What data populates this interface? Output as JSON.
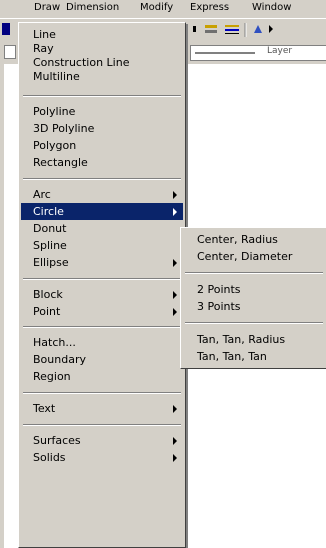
{
  "menubar": {
    "items": [
      "Draw",
      "Dimension",
      "Modify",
      "Express",
      "Window"
    ]
  },
  "toolbar": {
    "layer_field": "Layer"
  },
  "draw_menu": {
    "items": [
      {
        "label": "Line",
        "submenu": false
      },
      {
        "label": "Ray",
        "submenu": false
      },
      {
        "label": "Construction Line",
        "submenu": false
      },
      {
        "label": "Multiline",
        "submenu": false
      },
      {
        "label": "Polyline",
        "submenu": false
      },
      {
        "label": "3D Polyline",
        "submenu": false
      },
      {
        "label": "Polygon",
        "submenu": false
      },
      {
        "label": "Rectangle",
        "submenu": false
      },
      {
        "label": "Arc",
        "submenu": true
      },
      {
        "label": "Circle",
        "submenu": true,
        "selected": true
      },
      {
        "label": "Donut",
        "submenu": false
      },
      {
        "label": "Spline",
        "submenu": false
      },
      {
        "label": "Ellipse",
        "submenu": true
      },
      {
        "label": "Block",
        "submenu": true
      },
      {
        "label": "Point",
        "submenu": true
      },
      {
        "label": "Hatch...",
        "submenu": false
      },
      {
        "label": "Boundary",
        "submenu": false
      },
      {
        "label": "Region",
        "submenu": false
      },
      {
        "label": "Text",
        "submenu": true
      },
      {
        "label": "Surfaces",
        "submenu": true
      },
      {
        "label": "Solids",
        "submenu": true
      }
    ]
  },
  "circle_submenu": {
    "items": [
      "Center, Radius",
      "Center, Diameter",
      "2 Points",
      "3 Points",
      "Tan, Tan, Radius",
      "Tan, Tan, Tan"
    ]
  },
  "colors": {
    "menu_bg": "#d4d0c8",
    "selection": "#0a246a",
    "selection_text": "#ffffff"
  }
}
